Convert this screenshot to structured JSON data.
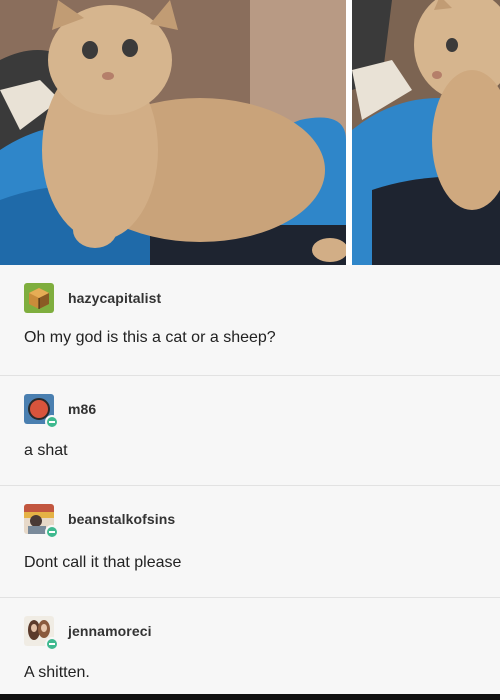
{
  "photos": [
    {
      "name": "curly kitten photo",
      "icon": "cat-photo"
    },
    {
      "name": "curly kitten photo close-up",
      "icon": "cat-photo"
    }
  ],
  "replies": [
    {
      "username": "hazycapitalist",
      "text": "Oh my god is this a cat or a sheep?",
      "avatar_icon": "cube-avatar",
      "follow_badge": false
    },
    {
      "username": "m86",
      "text": "a shat",
      "avatar_icon": "circle-avatar",
      "follow_badge": true
    },
    {
      "username": "beanstalkofsins",
      "text": "Dont call it that please",
      "avatar_icon": "photo-avatar",
      "follow_badge": true
    },
    {
      "username": "jennamoreci",
      "text": "A shitten.",
      "avatar_icon": "photo-avatar",
      "follow_badge": true
    }
  ],
  "colors": {
    "accent_follow": "#3fb98f",
    "blanket_blue": "#2f86c9",
    "cat_fur": "#c9a37a"
  }
}
